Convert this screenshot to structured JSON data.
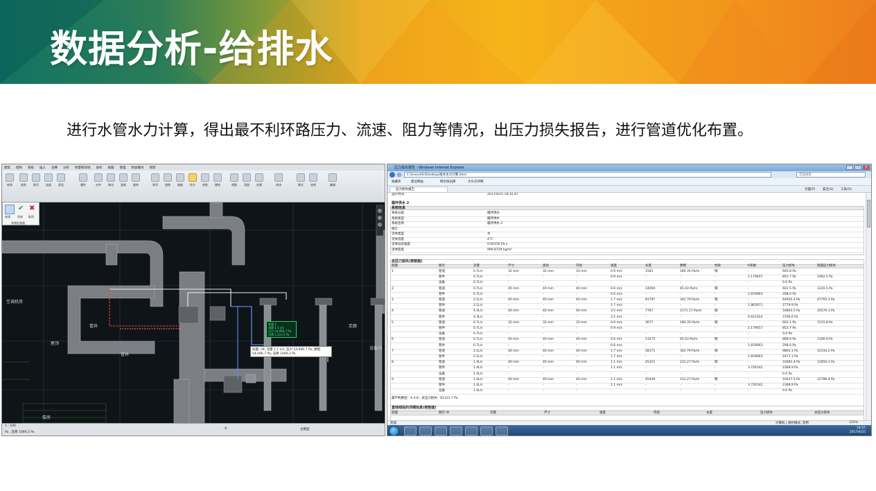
{
  "slide": {
    "title": "数据分析-给排水",
    "subtitle": "进行水管水力计算，得出最不利环路压力、流速、阻力等情况，出压力损失报告，进行管道优化布置。"
  },
  "revit": {
    "menu": [
      "建筑",
      "结构",
      "系统",
      "插入",
      "注释",
      "分析",
      "体量和场地",
      "协作",
      "视图",
      "管理",
      "附加模块",
      "修改"
    ],
    "tools": [
      "修改",
      "粘贴",
      "剪切",
      "连接",
      "类型",
      "属性",
      "对齐",
      "移动",
      "复制",
      "旋转",
      "阵列",
      "镜像",
      "缩放",
      "拆分",
      "修剪",
      "删除",
      "视图",
      "测量",
      "创建",
      "修改",
      "模式",
      "选择",
      "编辑"
    ],
    "panel": {
      "modify": "修改",
      "finish": "完成",
      "cancel": "取消",
      "mode": "系统检查器"
    },
    "canvas_labels": [
      "屋顶",
      "管井",
      "管井",
      "泵房",
      "走廊",
      "设备间",
      "空调机房"
    ],
    "tag_lines": [
      "管道 2",
      "流量 1.1 L/s",
      "压力 54,096.7 Pa",
      "压降 1,113.5 Pa"
    ],
    "tooltip": "标题: 29; 流量 1.1 L/s; 压力 54,096.7 Pa; 摩阻 54,096.7 Pa; 压降 1069.2 Pa",
    "status_left": "1 : 100",
    "status_msg": "Pa , 压降 1069.2 Pa",
    "status_model": "主模型",
    "status_value": ":0"
  },
  "ie": {
    "title": "压力损失报告 - Windows Internet Explorer",
    "address": "C:\\Users\\lfc\\Desktop\\给水水力计算.html",
    "search": "百度搜索",
    "fav": {
      "favorites": "收藏夹",
      "suggested": "建议网站",
      "webslice": "网页快讯库",
      "site": "大众点评网"
    },
    "tab": "压力损失报告",
    "commands": [
      "页面(P)",
      "安全(S)",
      "工具(O)"
    ],
    "report": {
      "top_label": "运行时间",
      "top_value": "2017/4/25 18:35:47",
      "section": "循环供水 2",
      "info_title": "系统信息",
      "info": [
        [
          "系统分类",
          "循环供水"
        ],
        [
          "系统类型",
          "循环供水"
        ],
        [
          "系统名称",
          "循环供水 2"
        ],
        [
          "缩写",
          ""
        ],
        [
          "流体类型",
          "水"
        ],
        [
          "流体温度",
          "4°C"
        ],
        [
          "流体动态粘度",
          "0.00156 Pa-s"
        ],
        [
          "流体密度",
          "999.8729 kg/m³"
        ]
      ],
      "table_title": "总压力损失(按剖面)",
      "columns": [
        "剖面",
        "图元",
        "流量",
        "尺寸",
        "直径",
        "内径",
        "速度",
        "长度",
        "摩擦",
        "材质",
        "K系数",
        "压力损失",
        "剖面压力损失"
      ],
      "rows": [
        [
          "1",
          "管道",
          "0.7L/s",
          "32 mm",
          "32 mm",
          "33 mm",
          "0.9 m/s",
          "3181",
          "180.35 Pa/m",
          "铜",
          "-",
          "605.8 Pa",
          ""
        ],
        [
          "",
          "管件",
          "0.7L/s",
          "-",
          "-",
          "-",
          "0.9 m/s",
          "-",
          "-",
          "-",
          "2.179457",
          "852.7 Pa",
          "1462.5 Pa"
        ],
        [
          "",
          "设备",
          "0.7L/s",
          "-",
          "-",
          "-",
          "-",
          "-",
          "-",
          "-",
          "-",
          "0.0 Pa",
          ""
        ],
        [
          "2",
          "管道",
          "0.7L/s",
          "40 mm",
          "40 mm",
          "40 mm",
          "0.6 m/s",
          "14094",
          "65.43 Pa/m",
          "铜",
          "-",
          "922.5 Pa",
          "1220.5 Pa"
        ],
        [
          "",
          "管件",
          "0.7L/s",
          "-",
          "-",
          "-",
          "0.6 m/s",
          "-",
          "-",
          "-",
          "1.659063",
          "298.0 Pa",
          ""
        ],
        [
          "3",
          "管道",
          "2.1L/s",
          "40 mm",
          "40 mm",
          "40 mm",
          "1.7 m/s",
          "81797",
          "342.79 Pa/m",
          "铜",
          "-",
          "44925.4 Pa",
          "47705.3 Pa"
        ],
        [
          "",
          "管件",
          "2.1L/s",
          "-",
          "-",
          "-",
          "1.7 m/s",
          "-",
          "-",
          "-",
          "1.863071",
          "2779.9 Pa",
          ""
        ],
        [
          "4",
          "管道",
          "4.3L/s",
          "40 mm",
          "40 mm",
          "40 mm",
          "3.5 m/s",
          "7767",
          "2171.17 Pa/m",
          "铜",
          "-",
          "16863.5 Pa",
          "20570.1 Pa"
        ],
        [
          "",
          "管件",
          "4.3L/s",
          "-",
          "-",
          "-",
          "3.5 m/s",
          "-",
          "-",
          "-",
          "0.621024",
          "3706.6 Pa",
          ""
        ],
        [
          "5",
          "管道",
          "0.7L/s",
          "32 mm",
          "32 mm",
          "33 mm",
          "0.9 m/s",
          "3677",
          "180.35 Pa/m",
          "铜",
          "-",
          "663.1 Pa",
          "1515.8 Pa"
        ],
        [
          "",
          "管件",
          "0.7L/s",
          "-",
          "-",
          "-",
          "0.9 m/s",
          "-",
          "-",
          "-",
          "2.179457",
          "852.7 Pa",
          ""
        ],
        [
          "",
          "设备",
          "0.7L/s",
          "-",
          "-",
          "-",
          "-",
          "-",
          "-",
          "-",
          "-",
          "0.0 Pa",
          ""
        ],
        [
          "6",
          "管道",
          "0.7L/s",
          "40 mm",
          "40 mm",
          "40 mm",
          "0.6 m/s",
          "13275",
          "65.43 Pa/m",
          "铜",
          "-",
          "868.9 Pa",
          "1166.9 Pa"
        ],
        [
          "",
          "管件",
          "0.7L/s",
          "-",
          "-",
          "-",
          "0.6 m/s",
          "-",
          "-",
          "-",
          "1.659063",
          "298.0 Pa",
          ""
        ],
        [
          "7",
          "管道",
          "2.1L/s",
          "40 mm",
          "40 mm",
          "40 mm",
          "1.7 m/s",
          "28171",
          "342.79 Pa/m",
          "铜",
          "-",
          "9863.1 Pa",
          "12334.2 Pa"
        ],
        [
          "",
          "管件",
          "2.1L/s",
          "-",
          "-",
          "-",
          "1.7 m/s",
          "-",
          "-",
          "-",
          "1.659063",
          "2471.1 Pa",
          ""
        ],
        [
          "8",
          "管道",
          "1.4L/s",
          "40 mm",
          "40 mm",
          "40 mm",
          "1.1 m/s",
          "45321",
          "231.27 Pa/m",
          "铜",
          "-",
          "10481.4 Pa",
          "12850.3 Pa"
        ],
        [
          "",
          "管件",
          "1.4L/s",
          "-",
          "-",
          "-",
          "1.1 m/s",
          "-",
          "-",
          "-",
          "3.726142",
          "2368.9 Pa",
          ""
        ],
        [
          "",
          "设备",
          "1.4L/s",
          "-",
          "-",
          "-",
          "-",
          "-",
          "-",
          "-",
          "-",
          "0.0 Pa",
          ""
        ],
        [
          "9",
          "管道",
          "1.4L/s",
          "40 mm",
          "40 mm",
          "40 mm",
          "1.1 m/s",
          "45449",
          "231.27 Pa/m",
          "铜",
          "-",
          "10417.5 Pa",
          "12786.4 Pa"
        ],
        [
          "",
          "管件",
          "1.4L/s",
          "-",
          "-",
          "-",
          "1.1 m/s",
          "-",
          "-",
          "-",
          "3.726142",
          "2368.9 Pa",
          ""
        ],
        [
          "",
          "设备",
          "1.4L/s",
          "-",
          "-",
          "-",
          "-",
          "-",
          "-",
          "-",
          "-",
          "0.0 Pa",
          ""
        ]
      ],
      "critical": "最不利路径：4-3-8 ; 总压力损失：81123.7 Pa",
      "detail_title": "直线线段的详细信息(按剖面)",
      "detail_columns": [
        "剖面",
        "图元 ID",
        "流量",
        "尺寸",
        "速度",
        "内径",
        "长度",
        "压力损失",
        "总压力损失"
      ]
    },
    "status_left": "完成",
    "status_mid": "计算机 | 保护模式: 禁用",
    "zoom": "125%",
    "clock_time": "18:37",
    "clock_date": "2017/4/25"
  }
}
